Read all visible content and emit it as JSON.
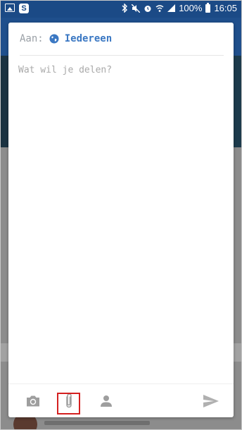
{
  "status_bar": {
    "battery": "100%",
    "time": "16:05",
    "left_icons": [
      "image-icon",
      "s-app-icon"
    ],
    "right_icons": [
      "bluetooth-icon",
      "mute-icon",
      "alarm-icon",
      "wifi-icon",
      "signal-icon",
      "battery-icon"
    ],
    "s_glyph": "S"
  },
  "compose": {
    "to_label": "Aan:",
    "audience": "Iedereen",
    "placeholder": "Wat wil je delen?"
  },
  "toolbar": {
    "items": [
      "camera-icon",
      "attach-icon",
      "person-icon",
      "send-icon"
    ],
    "highlighted": "attach-icon"
  },
  "colors": {
    "status_bar": "#1b4a86",
    "accent": "#3b78c3",
    "icon_gray": "#9e9e9e",
    "highlight": "#d42020"
  }
}
